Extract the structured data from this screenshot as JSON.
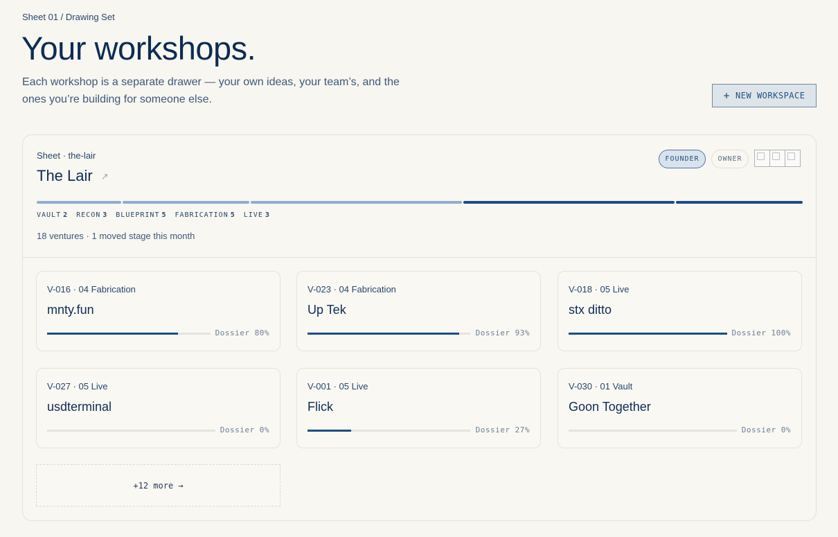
{
  "header": {
    "breadcrumb": "Sheet 01 / Drawing Set",
    "title": "Your workshops.",
    "description": "Each workshop is a separate drawer — your own ideas, your team’s, and the ones you’re building for someone else.",
    "new_button_label": "NEW WORKSPACE",
    "new_button_icon": "plus-icon"
  },
  "workshop": {
    "sheet": "Sheet · the-lair",
    "name": "The Lair",
    "roles": [
      "FOUNDER",
      "OWNER"
    ],
    "avatar_count": 3,
    "stages": [
      {
        "label": "VAULT",
        "count": "2",
        "color": "#8caed0"
      },
      {
        "label": "RECON",
        "count": "3",
        "color": "#8caed0"
      },
      {
        "label": "BLUEPRINT",
        "count": "5",
        "color": "#8caed0"
      },
      {
        "label": "FABRICATION",
        "count": "5",
        "color": "#1a4d87"
      },
      {
        "label": "LIVE",
        "count": "3",
        "color": "#1a4d87"
      }
    ],
    "summary": "18 ventures · 1 moved stage this month",
    "ventures": [
      {
        "meta": "V-016 · 04 Fabrication",
        "name": "mnty.fun",
        "dossier": "Dossier 80%",
        "progress": 0.8
      },
      {
        "meta": "V-023 · 04 Fabrication",
        "name": "Up Tek",
        "dossier": "Dossier 93%",
        "progress": 0.93
      },
      {
        "meta": "V-018 · 05 Live",
        "name": "stx ditto",
        "dossier": "Dossier 100%",
        "progress": 1.0
      },
      {
        "meta": "V-027 · 05 Live",
        "name": "usdterminal",
        "dossier": "Dossier 0%",
        "progress": 0
      },
      {
        "meta": "V-001 · 05 Live",
        "name": "Flick",
        "dossier": "Dossier 27%",
        "progress": 0.27
      },
      {
        "meta": "V-030 · 01 Vault",
        "name": "Goon Together",
        "dossier": "Dossier 0%",
        "progress": 0
      }
    ],
    "more_label": "+12 more →"
  }
}
